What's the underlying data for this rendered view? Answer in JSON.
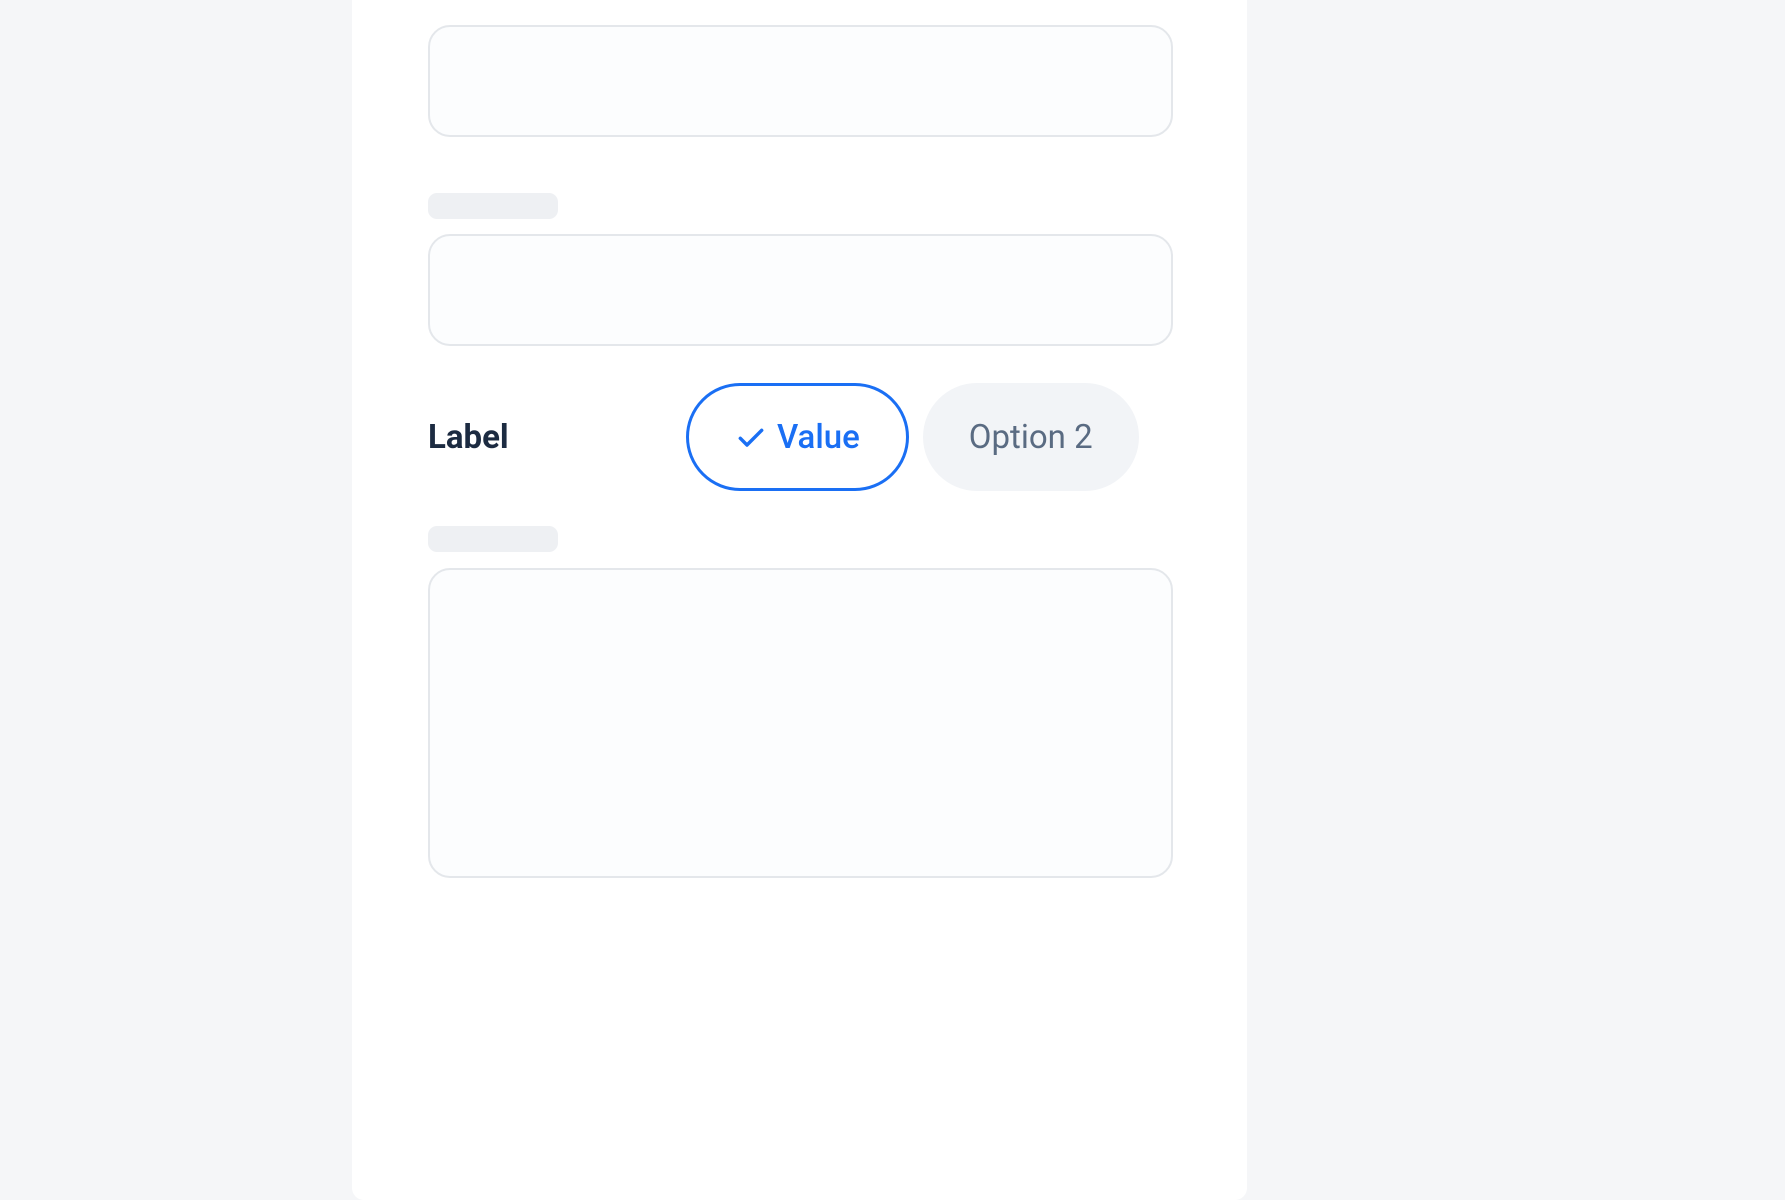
{
  "formSection": {
    "label": "Label",
    "option1": "Value",
    "option2": "Option 2"
  },
  "colors": {
    "accent": "#1a6ff4",
    "textDark": "#1c2b41",
    "textMuted": "#5a6b82",
    "skeleton": "#eef0f3",
    "border": "#e4e7eb",
    "pillBg": "#f2f4f7"
  }
}
